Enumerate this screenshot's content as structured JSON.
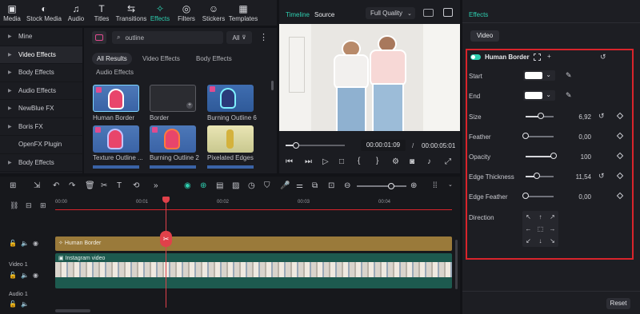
{
  "toolbar": {
    "tabs": [
      {
        "label": "Media",
        "icon": "media-icon"
      },
      {
        "label": "Stock Media",
        "icon": "stock-media-icon"
      },
      {
        "label": "Audio",
        "icon": "audio-icon"
      },
      {
        "label": "Titles",
        "icon": "titles-icon"
      },
      {
        "label": "Transitions",
        "icon": "transitions-icon"
      },
      {
        "label": "Effects",
        "icon": "effects-icon"
      },
      {
        "label": "Filters",
        "icon": "filters-icon"
      },
      {
        "label": "Stickers",
        "icon": "stickers-icon"
      },
      {
        "label": "Templates",
        "icon": "templates-icon"
      }
    ],
    "active": "Effects"
  },
  "categories": [
    "Mine",
    "Video Effects",
    "Body Effects",
    "Audio Effects",
    "NewBlue FX",
    "Boris FX",
    "OpenFX Plugin",
    "Body Effects"
  ],
  "browser": {
    "search_value": "outline",
    "filter_label": "All",
    "tabs": [
      "All Results",
      "Video Effects",
      "Body Effects",
      "Audio Effects"
    ],
    "items": [
      "Human Border",
      "Border",
      "Burning Outline 6",
      "Texture Outline ...",
      "Burning Outline 2",
      "Pixelated Edges"
    ]
  },
  "preview": {
    "tab_timeline": "Timeline",
    "tab_source": "Source",
    "quality": "Full Quality",
    "current_time": "00:00:01:09",
    "separator": "/",
    "total_time": "00:00:05:01",
    "progress": 0.17
  },
  "effects_panel": {
    "title": "Effects",
    "tab": "Video",
    "effect_name": "Human Border",
    "start_label": "Start",
    "end_label": "End",
    "params": [
      {
        "label": "Size",
        "value": "6,92",
        "fraction": 0.55
      },
      {
        "label": "Feather",
        "value": "0,00",
        "fraction": 0.0
      },
      {
        "label": "Opacity",
        "value": "100",
        "fraction": 1.0
      },
      {
        "label": "Edge Thickness",
        "value": "11,54",
        "fraction": 0.4
      },
      {
        "label": "Edge Feather",
        "value": "0,00",
        "fraction": 0.0
      }
    ],
    "direction_label": "Direction",
    "reset_label": "Reset",
    "accent": "#2ecfb0",
    "highlight": "#d8242b"
  },
  "timeline": {
    "ruler": [
      "00:00",
      "00:01",
      "00:02",
      "00:03",
      "00:04"
    ],
    "effect_clip": "Human Border",
    "video_clip": "Instagram video",
    "track_video": "Video 1",
    "track_audio": "Audio 1"
  }
}
